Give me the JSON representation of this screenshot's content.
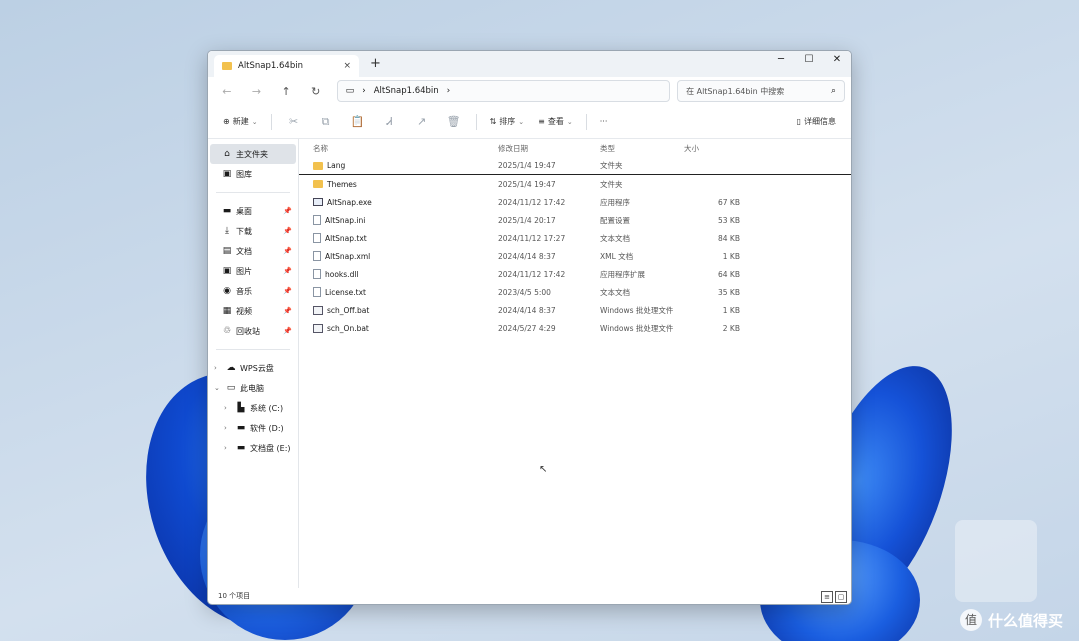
{
  "window": {
    "tab_title": "AltSnap1.64bin",
    "tab_close": "×",
    "tab_add": "+",
    "controls": {
      "minimize": "─",
      "maximize": "☐",
      "close": "✕"
    }
  },
  "addressbar": {
    "back": "←",
    "forward": "→",
    "up": "↑",
    "refresh": "↻",
    "monitor_icon": "▭",
    "chevron": "›",
    "path_segment": "AltSnap1.64bin",
    "search_placeholder": "在 AltSnap1.64bin 中搜索",
    "search_icon": "⌕"
  },
  "toolbar": {
    "new_label": "新建",
    "new_icon": "⊕",
    "cut": "✂",
    "copy": "⧉",
    "paste": "📋",
    "rename": "Ꮧ",
    "share": "↗",
    "delete": "🗑",
    "sort_label": "排序",
    "sort_icon": "⇅",
    "view_label": "查看",
    "view_icon": "≡",
    "more": "···",
    "details_label": "详细信息",
    "details_icon": "▯",
    "caret": "⌄"
  },
  "nav": {
    "top": [
      {
        "label": "主文件夹",
        "icon": "⌂"
      },
      {
        "label": "图库",
        "icon": "▣"
      }
    ],
    "quick": [
      {
        "label": "桌面",
        "icon": "▬"
      },
      {
        "label": "下载",
        "icon": "⤓"
      },
      {
        "label": "文档",
        "icon": "▤"
      },
      {
        "label": "图片",
        "icon": "▣"
      },
      {
        "label": "音乐",
        "icon": "◉"
      },
      {
        "label": "视频",
        "icon": "▦"
      },
      {
        "label": "回收站",
        "icon": "♲"
      }
    ],
    "pin": "📌",
    "tree": [
      {
        "label": "WPS云盘",
        "icon": "☁",
        "chev": "›"
      },
      {
        "label": "此电脑",
        "icon": "▭",
        "chev": "⌄"
      },
      {
        "label": "系统 (C:)",
        "icon": "▙",
        "chev": "›"
      },
      {
        "label": "软件 (D:)",
        "icon": "▬",
        "chev": "›"
      },
      {
        "label": "文档盘 (E:)",
        "icon": "▬",
        "chev": "›"
      }
    ]
  },
  "files": {
    "headers": {
      "name": "名称",
      "date": "修改日期",
      "type": "类型",
      "size": "大小"
    },
    "rows": [
      {
        "name": "Lang",
        "date": "2025/1/4 19:47",
        "type": "文件夹",
        "size": "",
        "icon": "folder"
      },
      {
        "name": "Themes",
        "date": "2025/1/4 19:47",
        "type": "文件夹",
        "size": "",
        "icon": "folder"
      },
      {
        "name": "AltSnap.exe",
        "date": "2024/11/12 17:42",
        "type": "应用程序",
        "size": "67 KB",
        "icon": "exe"
      },
      {
        "name": "AltSnap.ini",
        "date": "2025/1/4 20:17",
        "type": "配置设置",
        "size": "53 KB",
        "icon": "doc"
      },
      {
        "name": "AltSnap.txt",
        "date": "2024/11/12 17:27",
        "type": "文本文档",
        "size": "84 KB",
        "icon": "doc"
      },
      {
        "name": "AltSnap.xml",
        "date": "2024/4/14 8:37",
        "type": "XML 文档",
        "size": "1 KB",
        "icon": "doc"
      },
      {
        "name": "hooks.dll",
        "date": "2024/11/12 17:42",
        "type": "应用程序扩展",
        "size": "64 KB",
        "icon": "doc"
      },
      {
        "name": "License.txt",
        "date": "2023/4/5 5:00",
        "type": "文本文档",
        "size": "35 KB",
        "icon": "doc"
      },
      {
        "name": "sch_Off.bat",
        "date": "2024/4/14 8:37",
        "type": "Windows 批处理文件",
        "size": "1 KB",
        "icon": "bat"
      },
      {
        "name": "sch_On.bat",
        "date": "2024/5/27 4:29",
        "type": "Windows 批处理文件",
        "size": "2 KB",
        "icon": "bat"
      }
    ]
  },
  "status": {
    "count": "10 个项目",
    "view_details": "≡",
    "view_tiles": "▢"
  },
  "watermark": {
    "logo": "值",
    "text": "什么值得买"
  }
}
